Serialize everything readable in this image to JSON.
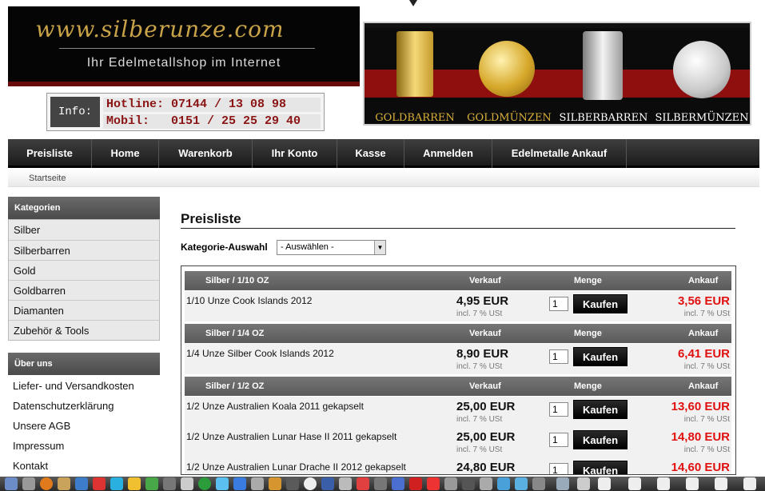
{
  "header": {
    "logo_url": "www.silberunze.com",
    "logo_tagline": "Ihr Edelmetallshop im Internet",
    "info_label": "Info:",
    "hotline": "Hotline: 07144 / 13 08 98",
    "mobil": "Mobil:   0151 / 25 25 29 40"
  },
  "banner": {
    "items": [
      {
        "label": "GOLDBARREN",
        "color": "#d8b03a"
      },
      {
        "label": "GOLDMÜNZEN",
        "color": "#d8b03a"
      },
      {
        "label": "SILBERBARREN",
        "color": "#ffffff"
      },
      {
        "label": "SILBERMÜNZEN",
        "color": "#ffffff"
      }
    ]
  },
  "nav": {
    "items": [
      "Preisliste",
      "Home",
      "Warenkorb",
      "Ihr Konto",
      "Kasse",
      "Anmelden",
      "Edelmetalle Ankauf"
    ]
  },
  "breadcrumb": "Startseite",
  "sidebar": {
    "kategorien_title": "Kategorien",
    "kategorien": [
      "Silber",
      "Silberbarren",
      "Gold",
      "Goldbarren",
      "Diamanten",
      "Zubehör & Tools"
    ],
    "ueber_title": "Über uns",
    "ueber": [
      "Liefer- und Versandkosten",
      "Datenschutzerklärung",
      "Unsere AGB",
      "Impressum",
      "Kontakt"
    ]
  },
  "main": {
    "title": "Preisliste",
    "kategorie_label": "Kategorie-Auswahl",
    "kategorie_value": "- Auswählen -",
    "col_verkauf": "Verkauf",
    "col_menge": "Menge",
    "col_ankauf": "Ankauf",
    "buy_label": "Kaufen",
    "vat_label": "incl. 7 % USt",
    "qty_default": "1",
    "groups": [
      {
        "name": "Silber / 1/10 OZ",
        "products": [
          {
            "name": "1/10 Unze Cook Islands 2012",
            "verkauf": "4,95 EUR",
            "ankauf": "3,56 EUR"
          }
        ]
      },
      {
        "name": "Silber / 1/4 OZ",
        "products": [
          {
            "name": "1/4 Unze Silber Cook Islands 2012",
            "verkauf": "8,90 EUR",
            "ankauf": "6,41 EUR"
          }
        ]
      },
      {
        "name": "Silber / 1/2 OZ",
        "products": [
          {
            "name": "1/2 Unze Australien Koala 2011 gekapselt",
            "verkauf": "25,00 EUR",
            "ankauf": "13,60 EUR"
          },
          {
            "name": "1/2 Unze Australien Lunar Hase II 2011 gekapselt",
            "verkauf": "25,00 EUR",
            "ankauf": "14,80 EUR"
          },
          {
            "name": "1/2 Unze Australien Lunar Drache II 2012 gekapselt",
            "verkauf": "24,80 EUR",
            "ankauf": "14,60 EUR"
          }
        ]
      }
    ]
  },
  "colors": {
    "logo_gold": "#c9a347",
    "hotline_red": "#8b1414",
    "ankauf_red": "#e01010",
    "nav_dark": "#1b1b1b"
  }
}
